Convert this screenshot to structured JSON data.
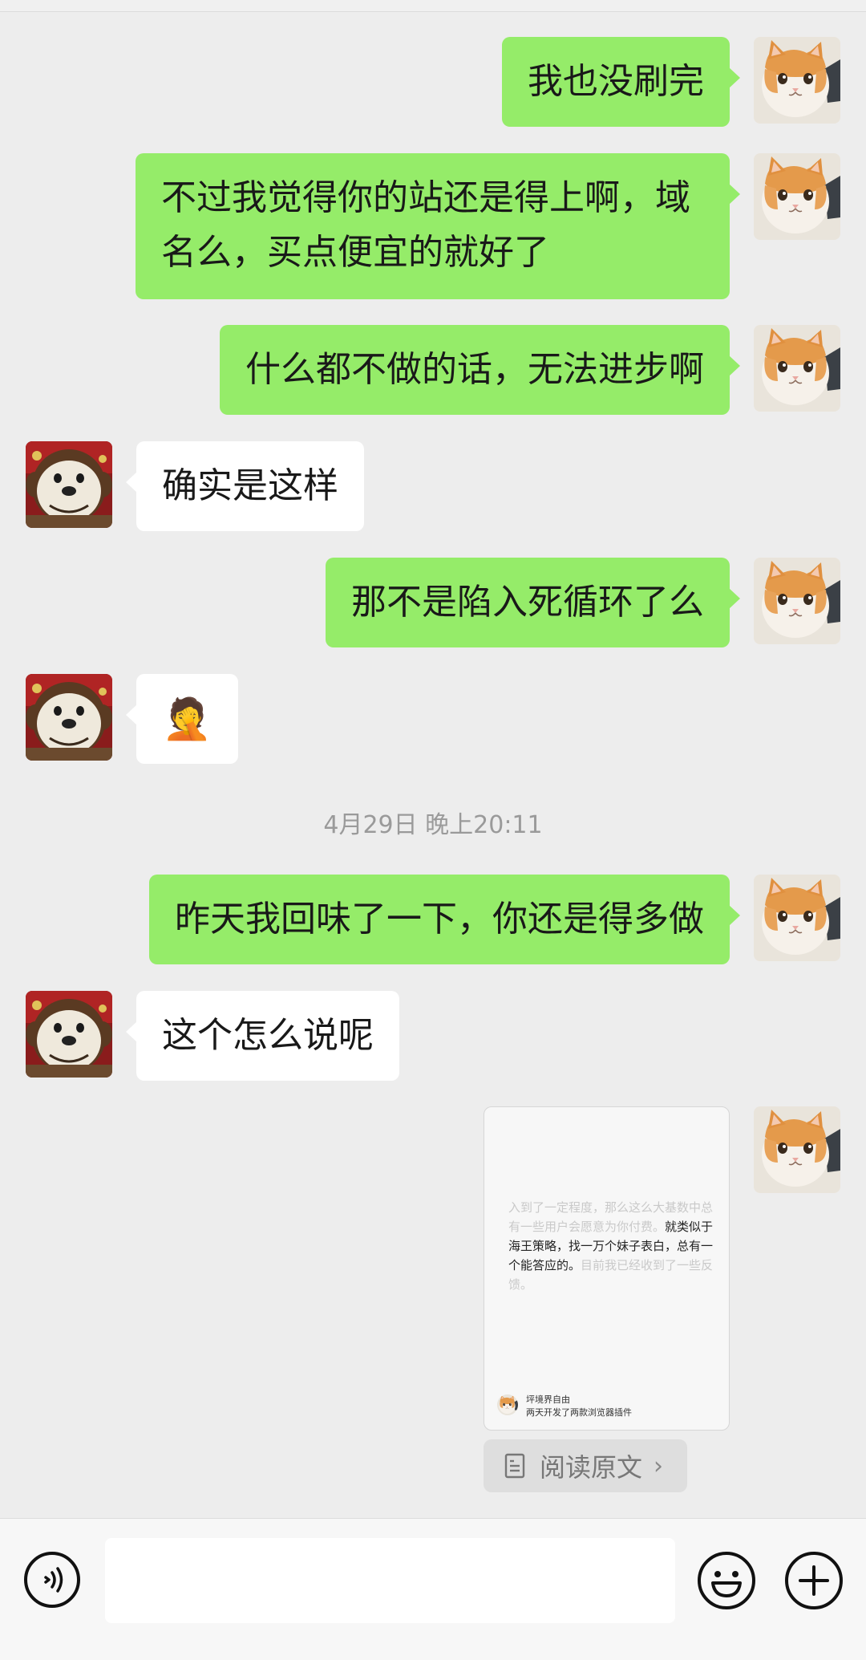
{
  "messages": [
    {
      "from": "me",
      "text": "我也没刷完"
    },
    {
      "from": "me",
      "line1": "不过我觉得你的站还是得上啊，域",
      "line2": "名么，买点便宜的就好了"
    },
    {
      "from": "me",
      "text": "什么都不做的话，无法进步啊"
    },
    {
      "from": "them",
      "text": "确实是这样"
    },
    {
      "from": "me",
      "text": "那不是陷入死循环了么"
    },
    {
      "from": "them",
      "text": "🤦"
    },
    {
      "from": "me",
      "text": "昨天我回味了一下，你还是得多做"
    },
    {
      "from": "them",
      "text": "这个怎么说呢"
    }
  ],
  "timestamp": "4月29日 晚上20:11",
  "article_card": {
    "text_faded_1": "入到了一定程度，那么这么大基数中总有一些用户会愿意为你付费。",
    "text_main": "就类似于海王策略，找一万个妹子表白，总有一个能答应的。",
    "text_faded_2": "目前我已经收到了一些反馈。",
    "author": "坪境界自由",
    "subtitle": "两天开发了两款浏览器插件"
  },
  "read_original": "阅读原文",
  "colors": {
    "my_bubble": "#95ec69",
    "their_bubble": "#ffffff",
    "background": "#ededed"
  },
  "icons": {
    "voice": "voice-icon",
    "emoji": "emoji-icon",
    "plus": "plus-icon",
    "document": "document-icon"
  }
}
